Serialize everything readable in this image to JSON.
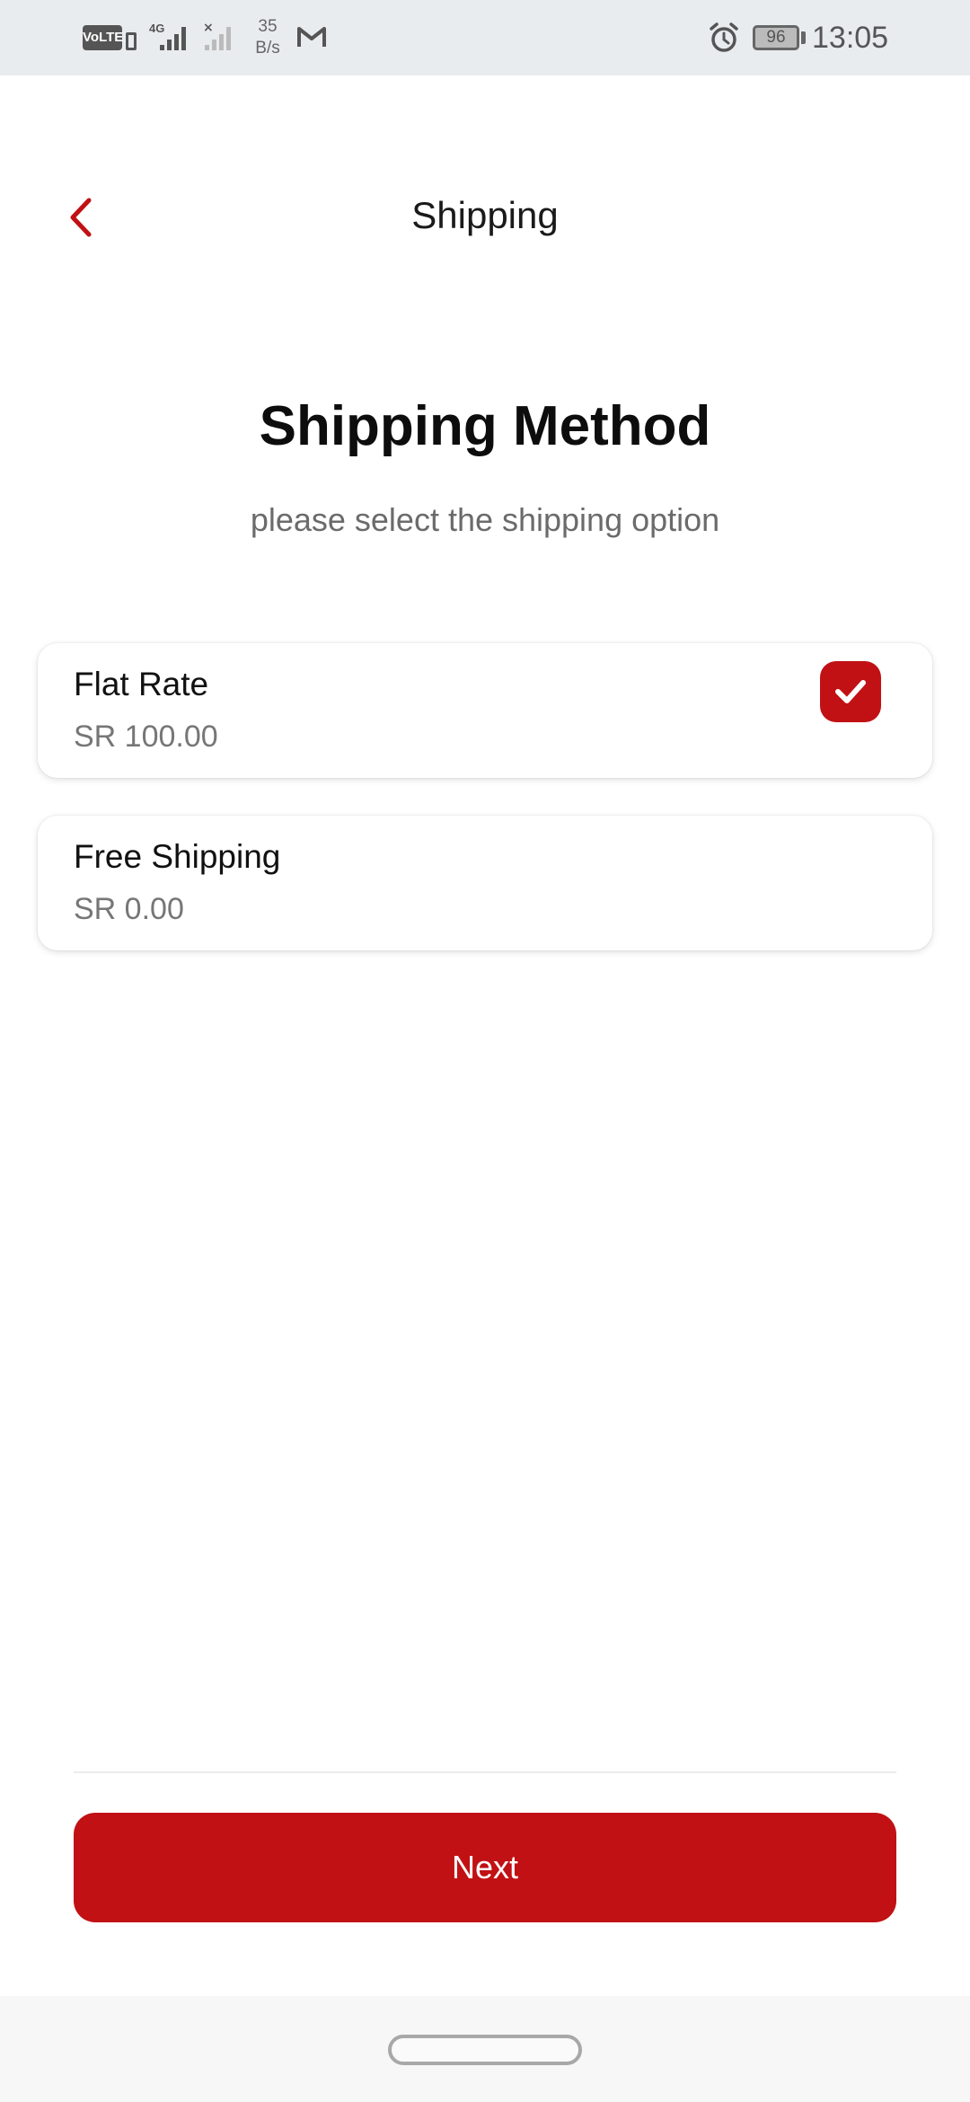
{
  "status_bar": {
    "volte": "VoLTE",
    "network": "4G",
    "speed_value": "35",
    "speed_unit": "B/s",
    "battery": "96",
    "time": "13:05",
    "icons": [
      "sim-icon",
      "signal-icon",
      "no-signal-icon",
      "gmail-icon",
      "alarm-icon",
      "battery-icon"
    ]
  },
  "header": {
    "back_icon": "chevron-left-icon",
    "title": "Shipping"
  },
  "main": {
    "heading": "Shipping Method",
    "subheading": "please select the shipping option",
    "options": [
      {
        "name": "Flat Rate",
        "price": "SR 100.00",
        "selected": true
      },
      {
        "name": "Free Shipping",
        "price": "SR 0.00",
        "selected": false
      }
    ]
  },
  "footer": {
    "next_label": "Next"
  },
  "colors": {
    "accent": "#c11114",
    "status_bar_bg": "#e9ecef",
    "text_primary": "#111111",
    "text_secondary": "#767676"
  }
}
